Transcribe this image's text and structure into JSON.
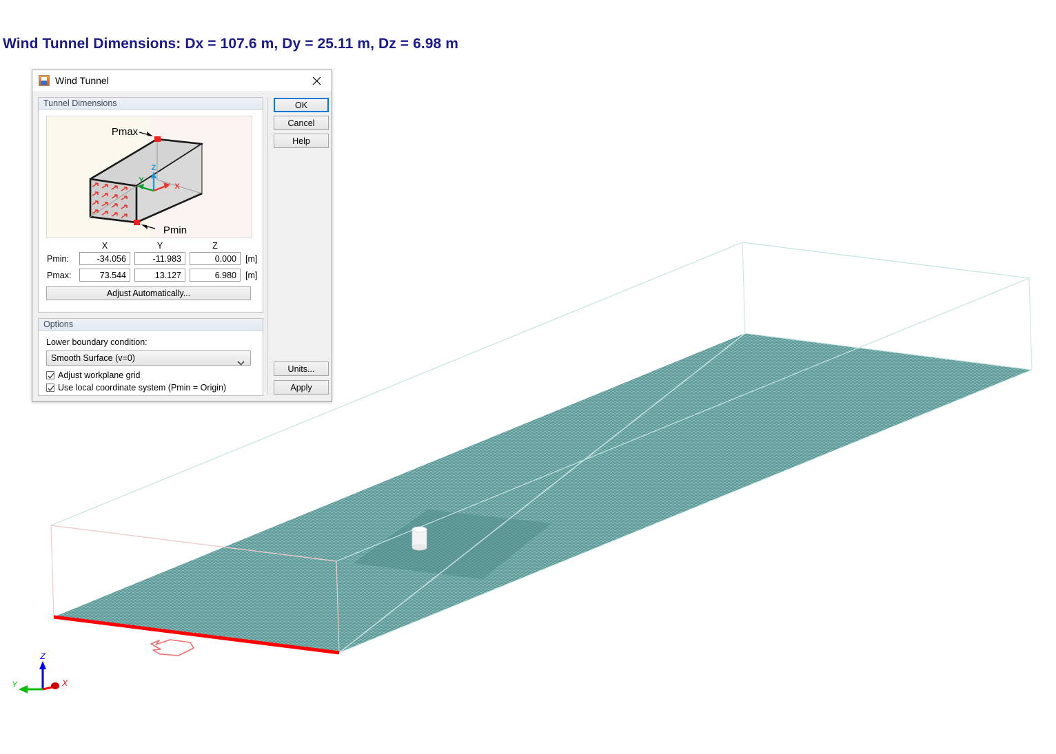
{
  "heading": "Wind Tunnel Dimensions: Dx = 107.6 m, Dy = 25.11 m, Dz = 6.98 m",
  "dialog": {
    "title": "Wind Tunnel",
    "icon": "app-icon",
    "close_glyph": "close-icon",
    "groups": {
      "dimensions": {
        "label": "Tunnel Dimensions",
        "picture": {
          "pmax_label": "Pmax",
          "pmin_label": "Pmin",
          "axis_x": "X",
          "axis_y": "Y",
          "axis_z": "Z"
        },
        "column_headers": [
          "X",
          "Y",
          "Z"
        ],
        "rows": [
          {
            "label": "Pmin:",
            "x": "-34.056",
            "y": "-11.983",
            "z": "0.000",
            "unit": "[m]"
          },
          {
            "label": "Pmax:",
            "x": "73.544",
            "y": "13.127",
            "z": "6.980",
            "unit": "[m]"
          }
        ],
        "adjust_button": "Adjust Automatically..."
      },
      "options": {
        "label": "Options",
        "boundary_label": "Lower boundary condition:",
        "boundary_value": "Smooth Surface (v=0)",
        "boundary_options": [
          "Smooth Surface (v=0)"
        ],
        "checkboxes": [
          {
            "label": "Adjust workplane grid",
            "checked": true
          },
          {
            "label": "Use local coordinate system (Pmin = Origin)",
            "checked": true
          }
        ]
      }
    },
    "buttons": {
      "ok": "OK",
      "cancel": "Cancel",
      "help": "Help",
      "units": "Units...",
      "apply": "Apply"
    }
  },
  "viewport": {
    "axis_triad": {
      "x": "X",
      "y": "Y",
      "z": "Z"
    },
    "colors": {
      "tunnel_edge": "#bfe2e0",
      "tunnel_inlet_edge": "#f6c6c6",
      "ground_bottom_edge": "#ff0000",
      "surface_fill": "#5d9a99",
      "surface_mesh": "#8fbdbc",
      "building": "#f2f2f2",
      "wind_arrow": "#e86a6a",
      "axis_x": "#ff0000",
      "axis_y": "#00c000",
      "axis_z": "#0000ff",
      "heading": "#1a1a8c"
    }
  }
}
